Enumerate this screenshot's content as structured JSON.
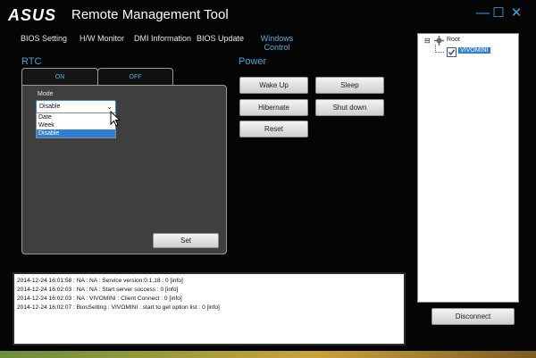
{
  "titlebar": {
    "logo": "ASUS",
    "title": "Remote Management Tool",
    "minimize_label": "—",
    "maximize_label": "☐",
    "close_label": "✕"
  },
  "menu": {
    "items": [
      {
        "label": "BIOS Setting"
      },
      {
        "label": "H/W Monitor"
      },
      {
        "label": "DMI Information"
      },
      {
        "label": "BIOS Update"
      },
      {
        "label_line1": "Windows",
        "label_line2": "Control"
      }
    ]
  },
  "rtc": {
    "title": "RTC",
    "tabs": [
      {
        "label": "ON"
      },
      {
        "label": "OFF"
      }
    ],
    "mode_label": "Mode",
    "mode_value": "Disable",
    "mode_options": [
      {
        "label": "Date",
        "selected": false
      },
      {
        "label": "Week",
        "selected": false
      },
      {
        "label": "Disable",
        "selected": true
      }
    ],
    "set_button": "Set"
  },
  "power": {
    "title": "Power",
    "buttons": {
      "wake_up": "Wake Up",
      "sleep": "Sleep",
      "hibernate": "Hibernate",
      "shut_down": "Shut down",
      "reset": "Reset"
    }
  },
  "log": {
    "lines": [
      "2014-12-24 16:01:58 : NA : NA : Service version:0.1.18 : 0 [info]",
      "2014-12-24 16:02:03 : NA : NA : Start server success : 0 [info]",
      "2014-12-24 16:02:03 : NA : VIVOMINI : Client Connect : 0 [info]",
      "2014-12-24 16:02:07 : BiosSetting : VIVOMINI : start to get option list : 0 [info]"
    ]
  },
  "tree": {
    "root_label": "Root",
    "expander": "⊟",
    "node_label": "VIVOMINI",
    "node_checked": true
  },
  "disconnect_button": "Disconnect",
  "colors": {
    "accent": "#4aa2de",
    "window_bg": "#050505",
    "panel_bg": "#3f3f3f",
    "selection": "#2f7fd6"
  }
}
